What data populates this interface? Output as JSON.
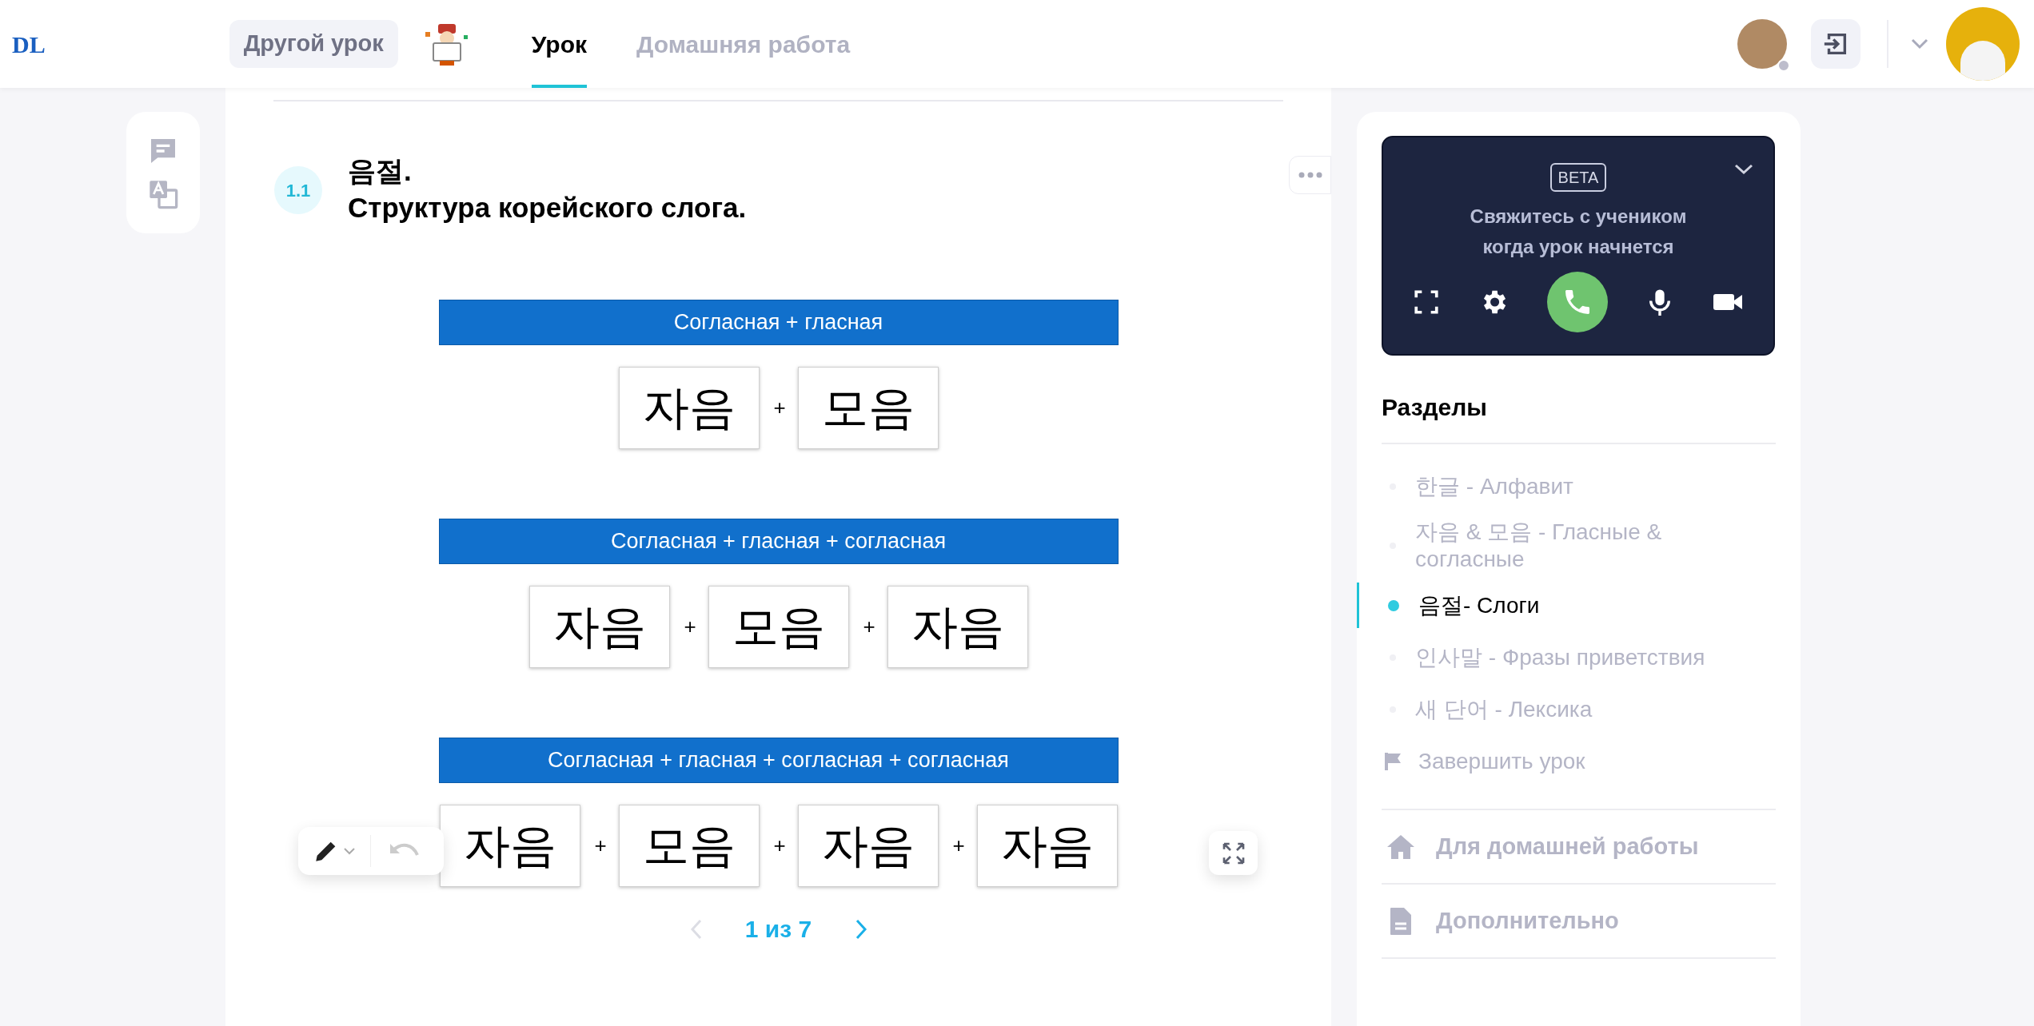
{
  "header": {
    "logo": "DL",
    "other_lesson_button": "Другой урок",
    "tabs": [
      {
        "label": "Урок",
        "selected": true
      },
      {
        "label": "Домашняя работа",
        "selected": false
      }
    ],
    "student_online": false
  },
  "lesson": {
    "number": "1.1",
    "title_lines": [
      "음절.",
      "Структура корейского слога."
    ],
    "diagrams": [
      {
        "caption": "Согласная + гласная",
        "blocks": [
          {
            "kind": "word",
            "text": "자음"
          },
          {
            "kind": "plus",
            "text": "+"
          },
          {
            "kind": "word",
            "text": "모음"
          }
        ]
      },
      {
        "caption": "Согласная + гласная + согласная",
        "blocks": [
          {
            "kind": "word",
            "text": "자음"
          },
          {
            "kind": "plus",
            "text": "+"
          },
          {
            "kind": "word",
            "text": "모음"
          },
          {
            "kind": "plus",
            "text": "+"
          },
          {
            "kind": "word",
            "text": "자음"
          }
        ]
      },
      {
        "caption": "Согласная + гласная + согласная + согласная",
        "blocks": [
          {
            "kind": "word",
            "text": "자음"
          },
          {
            "kind": "plus",
            "text": "+"
          },
          {
            "kind": "word",
            "text": "모음"
          },
          {
            "kind": "plus",
            "text": "+"
          },
          {
            "kind": "word",
            "text": "자음"
          },
          {
            "kind": "plus",
            "text": "+"
          },
          {
            "kind": "word",
            "text": "자음"
          }
        ]
      }
    ],
    "pagination": {
      "label": "1 из 7",
      "prev_disabled": true,
      "next_disabled": false
    }
  },
  "call_panel": {
    "badge": "BETA",
    "message": "Свяжитесь с учеником когда урок начнется"
  },
  "sections": {
    "title": "Разделы",
    "items": [
      {
        "label": "한글 - Алфавит",
        "selected": false
      },
      {
        "label": "자음 & 모음 - Гласные & согласные",
        "selected": false
      },
      {
        "label": "음절- Слоги",
        "selected": true
      },
      {
        "label": "인사말 - Фразы приветствия",
        "selected": false
      },
      {
        "label": "새 단어 - Лексика",
        "selected": false
      }
    ],
    "finish": "Завершить урок",
    "links": [
      {
        "kind": "home",
        "label": "Для домашней работы"
      },
      {
        "kind": "document",
        "label": "Дополнительно"
      }
    ]
  }
}
